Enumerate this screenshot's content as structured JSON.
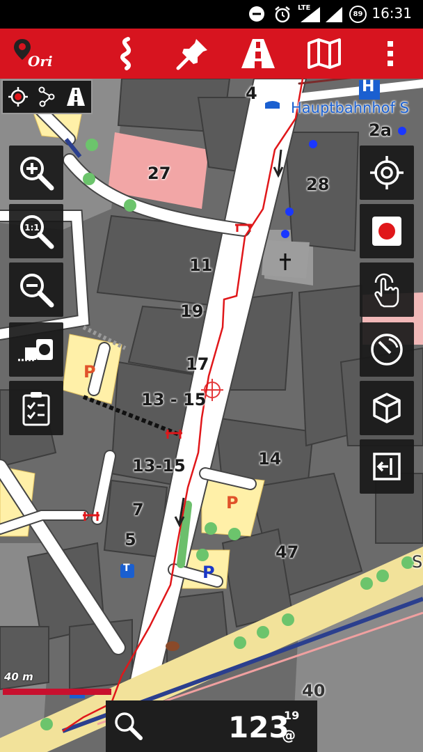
{
  "status_bar": {
    "time": "16:31",
    "network_label": "LTE",
    "battery_level": "89",
    "icons": [
      "do-not-disturb-icon",
      "alarm-icon",
      "cell-signal-icon",
      "wifi-signal-icon",
      "battery-icon"
    ]
  },
  "toolbar": {
    "app_logo_text": "Ori",
    "buttons": [
      "logo-menu-button",
      "route-button",
      "pin-button",
      "road-button",
      "map-button",
      "overflow-menu-button"
    ]
  },
  "mode_bar": {
    "buttons": [
      "gps-mode-icon",
      "route-mode-icon",
      "road-mode-icon"
    ]
  },
  "map": {
    "labels": {
      "hauptbahnhof": "Hauptbahnhof S",
      "h": "H",
      "n4": "4",
      "n2a": "2a",
      "n27": "27",
      "n28": "28",
      "n11": "11",
      "n19": "19",
      "n17": "17",
      "n13_15a": "13 - 15",
      "n13_15b": "13-15",
      "n14": "14",
      "n7": "7",
      "n5": "5",
      "n47": "47",
      "n40": "40",
      "p1": "P",
      "p2": "P",
      "p3": "P",
      "t": "T",
      "s": "S"
    },
    "colors": {
      "building": "#4f4f4f",
      "road": "#ffffff",
      "route": "#e0171a",
      "parking": "#fff3b0",
      "pink_building": "#f5b5b5"
    }
  },
  "left_controls": [
    "zoom-in-icon",
    "zoom-1-1-icon",
    "zoom-out-icon",
    "camera-icon",
    "clipboard-icon"
  ],
  "left_controls_text": {
    "one_to_one": "1:1"
  },
  "right_controls": [
    "gps-crosshair-icon",
    "record-icon",
    "touch-icon",
    "compass-icon",
    "3d-cube-icon",
    "exit-icon"
  ],
  "scale": {
    "label": "40 m"
  },
  "bottom_panel": {
    "value": "123",
    "superscript": "19",
    "unit": "@"
  }
}
